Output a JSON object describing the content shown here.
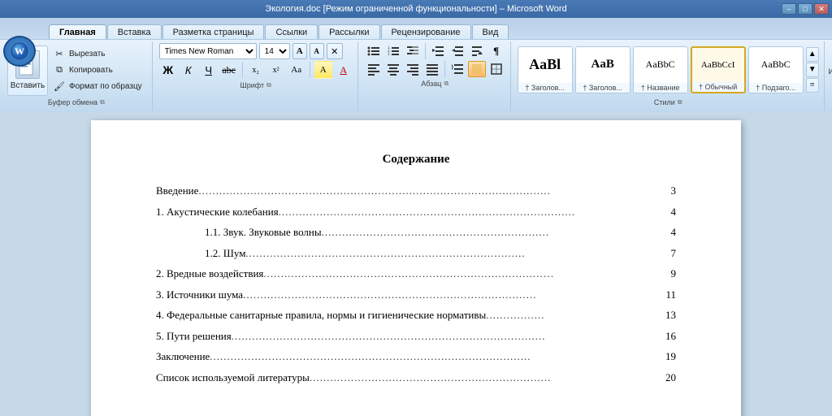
{
  "titlebar": {
    "title": "Экология.doc [Режим ограниченной функциональности] – Microsoft Word",
    "minimize": "–",
    "maximize": "□",
    "close": "✕"
  },
  "tabs": [
    {
      "id": "home",
      "label": "Главная",
      "active": true
    },
    {
      "id": "insert",
      "label": "Вставка",
      "active": false
    },
    {
      "id": "layout",
      "label": "Разметка страницы",
      "active": false
    },
    {
      "id": "refs",
      "label": "Ссылки",
      "active": false
    },
    {
      "id": "mailing",
      "label": "Рассылки",
      "active": false
    },
    {
      "id": "review",
      "label": "Рецензирование",
      "active": false
    },
    {
      "id": "view",
      "label": "Вид",
      "active": false
    }
  ],
  "clipboard": {
    "label": "Буфер обмена",
    "paste": "Вставить",
    "cut": "Вырезать",
    "copy": "Копировать",
    "format": "Формат по образцу"
  },
  "font": {
    "label": "Шрифт",
    "name": "Times New Roman",
    "size": "14",
    "bold": "Ж",
    "italic": "К",
    "underline": "Ч"
  },
  "paragraph": {
    "label": "Абзац"
  },
  "styles": {
    "label": "Стили",
    "items": [
      {
        "id": "heading1",
        "label": "† Заголов...",
        "preview": "AaBl",
        "preview_size": "large"
      },
      {
        "id": "heading2",
        "label": "† Заголов...",
        "preview": "AaB",
        "preview_size": "medium"
      },
      {
        "id": "title",
        "label": "† Название",
        "preview": "AaBbC",
        "preview_size": "medium"
      },
      {
        "id": "normal",
        "label": "† Обычный",
        "preview": "AaBbCcI",
        "preview_size": "small",
        "active": true
      },
      {
        "id": "subtitle",
        "label": "† Подзаго...",
        "preview": "AaBbC",
        "preview_size": "medium"
      }
    ],
    "change_label": "Изменить\nстили"
  },
  "document": {
    "title": "Содержание",
    "toc": [
      {
        "text": "Введение",
        "dots": "......................................................................................................",
        "page": "3",
        "indent": 0
      },
      {
        "text": "1. Акустические колебания",
        "dots": "......................................................................................",
        "page": "4",
        "indent": 0
      },
      {
        "text": "1.1. Звук. Звуковые волны",
        "dots": "..................................................................",
        "page": "4",
        "indent": 1
      },
      {
        "text": "1.2. Шум",
        "dots": ".................................................................................",
        "page": "7",
        "indent": 1
      },
      {
        "text": "2. Вредные воздействия",
        "dots": ".................................................................................…",
        "page": "9",
        "indent": 0
      },
      {
        "text": "3. Источники шума",
        "dots": ".....................................................................................",
        "page": "11",
        "indent": 0
      },
      {
        "text": "4. Федеральные санитарные правила, нормы и гигиенические нормативы",
        "dots": ".................",
        "page": "13",
        "indent": 0
      },
      {
        "text": "5. Пути решения",
        "dots": "...........................................................................................",
        "page": "16",
        "indent": 0
      },
      {
        "text": "Заключение",
        "dots": ".............................................................................................",
        "page": "19",
        "indent": 0
      },
      {
        "text": "Список используемой литературы",
        "dots": "......................................................................",
        "page": "20",
        "indent": 0
      }
    ]
  }
}
